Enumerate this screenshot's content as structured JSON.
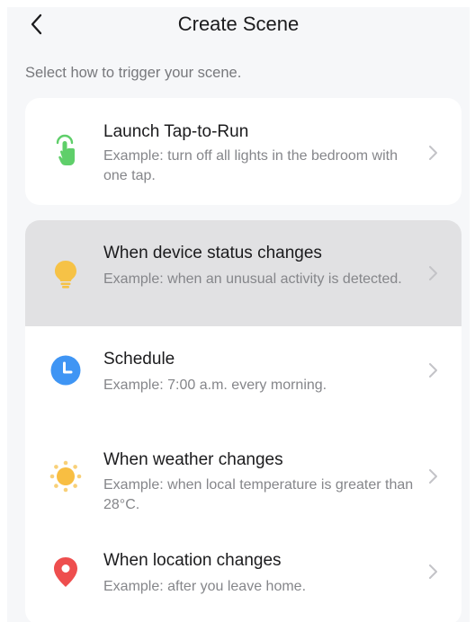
{
  "header": {
    "title": "Create Scene",
    "back_icon": "chevron-left-icon"
  },
  "subtitle": "Select how to trigger your scene.",
  "tap_to_run": {
    "title": "Launch Tap-to-Run",
    "desc": "Example: turn off all lights in the bedroom with one tap.",
    "icon": "tap-hand-icon",
    "color": "#5fcf6a"
  },
  "conditions": [
    {
      "title": "When device status changes",
      "desc": "Example: when an unusual activity is detected.",
      "icon": "light-bulb-icon",
      "color": "#f6c246"
    },
    {
      "title": "Schedule",
      "desc": "Example: 7:00 a.m. every morning.",
      "icon": "clock-icon",
      "color": "#3f95f4"
    },
    {
      "title": "When weather changes",
      "desc": "Example: when local temperature is greater than 28°C.",
      "icon": "sun-icon",
      "color": "#f8be42"
    },
    {
      "title": "When location changes",
      "desc": "Example: after you leave home.",
      "icon": "location-pin-icon",
      "color": "#ee4e4e"
    }
  ],
  "colors": {
    "background": "#f6f7f9",
    "card": "#ffffff",
    "highlight": "#e1e1e3",
    "chevron": "#c3c3c7"
  }
}
